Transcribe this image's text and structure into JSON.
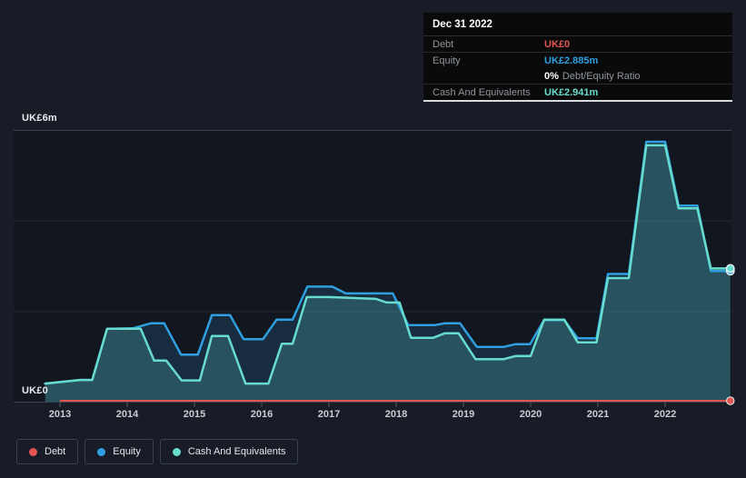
{
  "tooltip": {
    "date": "Dec 31 2022",
    "rows": [
      {
        "series": "debt",
        "label": "Debt",
        "value": "UK£0"
      },
      {
        "series": "equity",
        "label": "Equity",
        "value": "UK£2.885m",
        "sub_bold": "0%",
        "sub_text": "Debt/Equity Ratio"
      },
      {
        "series": "cash",
        "label": "Cash And Equivalents",
        "value": "UK£2.941m"
      }
    ]
  },
  "y_axis": {
    "top_label": "UK£6m",
    "bottom_label": "UK£0"
  },
  "x_axis": {
    "years": [
      "2013",
      "2014",
      "2015",
      "2016",
      "2017",
      "2018",
      "2019",
      "2020",
      "2021",
      "2022"
    ]
  },
  "legend": [
    {
      "series": "debt",
      "label": "Debt"
    },
    {
      "series": "equity",
      "label": "Equity"
    },
    {
      "series": "cash",
      "label": "Cash And Equivalents"
    }
  ],
  "colors": {
    "debt": "#e25550",
    "equity": "#2f9fe0",
    "cash": "#67dccd",
    "equity_fill": "rgba(47,159,224,0.16)",
    "cash_fill": "rgba(103,220,205,0.22)",
    "background": "#171c26",
    "plot_background": "#12161f",
    "grid_major": "#3d4450",
    "grid_minor": "#232a36",
    "tick": "#566070",
    "marker_ring": "#eaf3f4"
  },
  "chart_data": {
    "type": "area",
    "x_range": [
      2012.78,
      2022.98
    ],
    "ylim": [
      0,
      6
    ],
    "y_unit": "UK£ millions",
    "gridline_values": [
      0,
      2,
      4,
      6
    ],
    "legend_position": "bottom-left",
    "series": [
      {
        "name": "Debt",
        "color_key": "debt",
        "points": [
          [
            2013.0,
            0
          ],
          [
            2022.97,
            0
          ]
        ]
      },
      {
        "name": "Equity",
        "color_key": "equity",
        "points": [
          [
            2012.78,
            0.4
          ],
          [
            2013.3,
            0.48
          ],
          [
            2013.48,
            0.48
          ],
          [
            2013.7,
            1.61
          ],
          [
            2014.08,
            1.62
          ],
          [
            2014.35,
            1.73
          ],
          [
            2014.55,
            1.73
          ],
          [
            2014.8,
            1.04
          ],
          [
            2015.05,
            1.04
          ],
          [
            2015.26,
            1.91
          ],
          [
            2015.53,
            1.91
          ],
          [
            2015.73,
            1.38
          ],
          [
            2016.02,
            1.38
          ],
          [
            2016.22,
            1.81
          ],
          [
            2016.46,
            1.81
          ],
          [
            2016.68,
            2.54
          ],
          [
            2017.05,
            2.54
          ],
          [
            2017.25,
            2.39
          ],
          [
            2017.95,
            2.39
          ],
          [
            2018.18,
            1.69
          ],
          [
            2018.57,
            1.69
          ],
          [
            2018.72,
            1.73
          ],
          [
            2018.95,
            1.73
          ],
          [
            2019.2,
            1.21
          ],
          [
            2019.6,
            1.21
          ],
          [
            2019.78,
            1.27
          ],
          [
            2019.99,
            1.27
          ],
          [
            2020.2,
            1.8
          ],
          [
            2020.5,
            1.8
          ],
          [
            2020.7,
            1.4
          ],
          [
            2020.98,
            1.4
          ],
          [
            2021.15,
            2.82
          ],
          [
            2021.46,
            2.82
          ],
          [
            2021.72,
            5.74
          ],
          [
            2022.0,
            5.74
          ],
          [
            2022.2,
            4.33
          ],
          [
            2022.48,
            4.33
          ],
          [
            2022.68,
            2.885
          ],
          [
            2022.97,
            2.885
          ]
        ],
        "end_value": 2.885
      },
      {
        "name": "Cash And Equivalents",
        "color_key": "cash",
        "points": [
          [
            2012.78,
            0.4
          ],
          [
            2013.3,
            0.48
          ],
          [
            2013.48,
            0.48
          ],
          [
            2013.7,
            1.61
          ],
          [
            2014.2,
            1.61
          ],
          [
            2014.4,
            0.91
          ],
          [
            2014.58,
            0.91
          ],
          [
            2014.81,
            0.47
          ],
          [
            2015.08,
            0.47
          ],
          [
            2015.26,
            1.45
          ],
          [
            2015.5,
            1.45
          ],
          [
            2015.76,
            0.4
          ],
          [
            2016.1,
            0.4
          ],
          [
            2016.3,
            1.28
          ],
          [
            2016.46,
            1.28
          ],
          [
            2016.67,
            2.31
          ],
          [
            2017.0,
            2.31
          ],
          [
            2017.7,
            2.27
          ],
          [
            2017.86,
            2.19
          ],
          [
            2018.05,
            2.19
          ],
          [
            2018.22,
            1.41
          ],
          [
            2018.55,
            1.41
          ],
          [
            2018.72,
            1.51
          ],
          [
            2018.93,
            1.51
          ],
          [
            2019.18,
            0.94
          ],
          [
            2019.6,
            0.94
          ],
          [
            2019.78,
            1.01
          ],
          [
            2020.0,
            1.01
          ],
          [
            2020.2,
            1.81
          ],
          [
            2020.5,
            1.81
          ],
          [
            2020.7,
            1.31
          ],
          [
            2020.98,
            1.31
          ],
          [
            2021.15,
            2.73
          ],
          [
            2021.46,
            2.73
          ],
          [
            2021.72,
            5.66
          ],
          [
            2022.0,
            5.66
          ],
          [
            2022.2,
            4.27
          ],
          [
            2022.48,
            4.27
          ],
          [
            2022.68,
            2.941
          ],
          [
            2022.97,
            2.941
          ]
        ],
        "end_value": 2.941
      }
    ]
  }
}
